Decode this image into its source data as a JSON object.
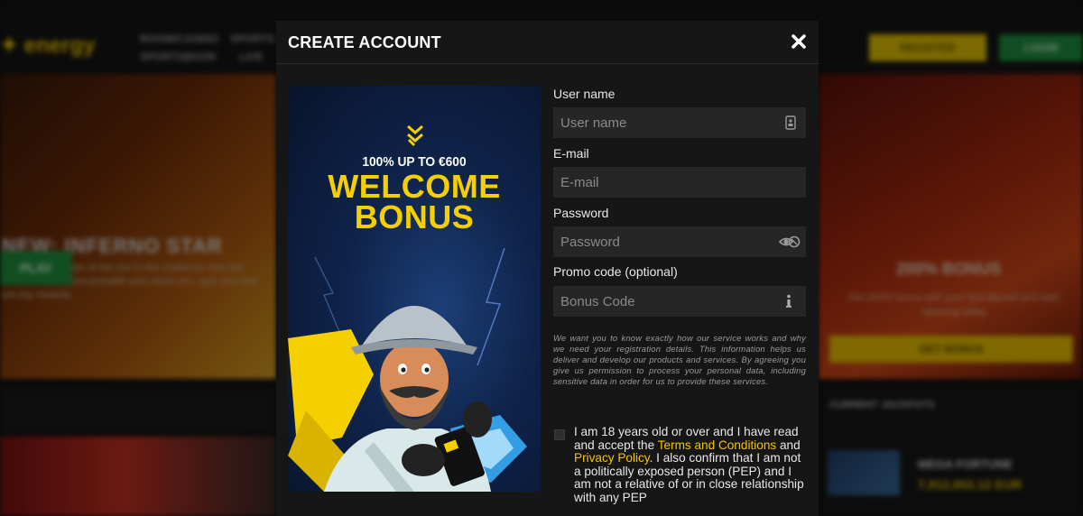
{
  "modal": {
    "title": "CREATE ACCOUNT",
    "close_icon": "close-icon"
  },
  "banner": {
    "subtitle": "100% UP TO €600",
    "title_line1": "WELCOME",
    "title_line2": "BONUS",
    "brand_color": "#f5d000"
  },
  "form": {
    "username": {
      "label": "User name",
      "placeholder": "User name",
      "icon": "id-card-icon"
    },
    "email": {
      "label": "E-mail",
      "placeholder": "E-mail"
    },
    "password": {
      "label": "Password",
      "placeholder": "Password",
      "icon": "eye-icon"
    },
    "promo": {
      "label": "Promo code (optional)",
      "placeholder": "Bonus Code",
      "icon": "info-icon"
    }
  },
  "legal_text": "We want you to know exactly how our service works and why we need your registration details. This information helps us deliver and develop our products and services. By agreeing you give us permission to process your personal data, including sensitive data in order for us to provide these services.",
  "consent": {
    "part1": "I am 18 years old or over and I have read and accept the ",
    "terms_link": "Terms and Conditions",
    "part2": " and ",
    "privacy_link": "Privacy Policy",
    "part3": ". I also confirm that I am not a politically exposed person (PEP) and I am not a relative of or in close relationship with any PEP",
    "link_color": "#f2c400"
  },
  "background": {
    "hero_title": "NEW: INFERNO STAR",
    "hero_text": "Harness the power of the sun in this explosive new slot from ELK. Greatest possible wins await you, spin now and win big rewards.",
    "play_label": "PLAY",
    "register_label": "REGISTER",
    "login_label": "LOGIN",
    "promo_title": "200% BONUS",
    "promo_text": "Get 200% bonus with your first deposit and start spinning today",
    "promo_button": "GET BONUS",
    "jackpots_title": "CURRENT JACKPOTS",
    "jackpot_name": "MEGA FORTUNE",
    "jackpot_amount": "7,912,653.12 EUR",
    "nav1": "ROOM/CASINO",
    "nav2": "SPORTS",
    "nav3": "SPORTSBOOK",
    "nav4": "LIVE"
  }
}
